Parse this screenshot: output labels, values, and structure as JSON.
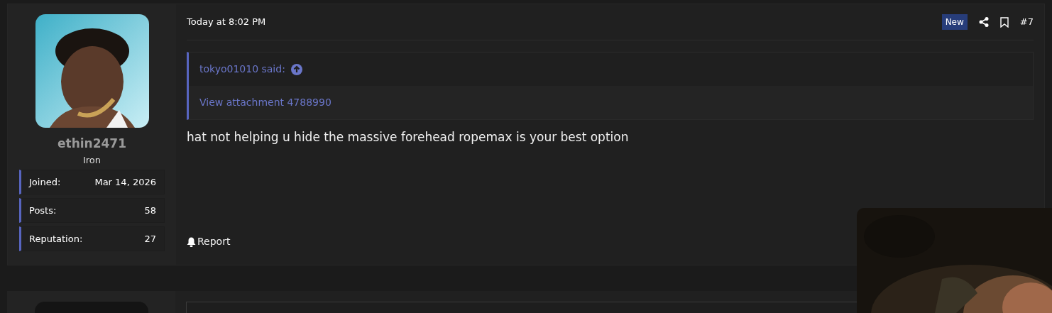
{
  "post": {
    "timestamp": "Today at 8:02 PM",
    "badge": "New",
    "post_number": "#7",
    "author": {
      "username": "ethin2471",
      "rank": "Iron",
      "stats": [
        {
          "label": "Joined:",
          "value": "Mar 14, 2026"
        },
        {
          "label": "Posts:",
          "value": "58"
        },
        {
          "label": "Reputation:",
          "value": "27"
        }
      ]
    },
    "quote": {
      "attribution": "tokyo01010 said:",
      "attachment_link": "View attachment 4788990"
    },
    "message": "hat not helping u hide the massive forehead ropemax is your best option",
    "actions": [
      "Report"
    ]
  }
}
